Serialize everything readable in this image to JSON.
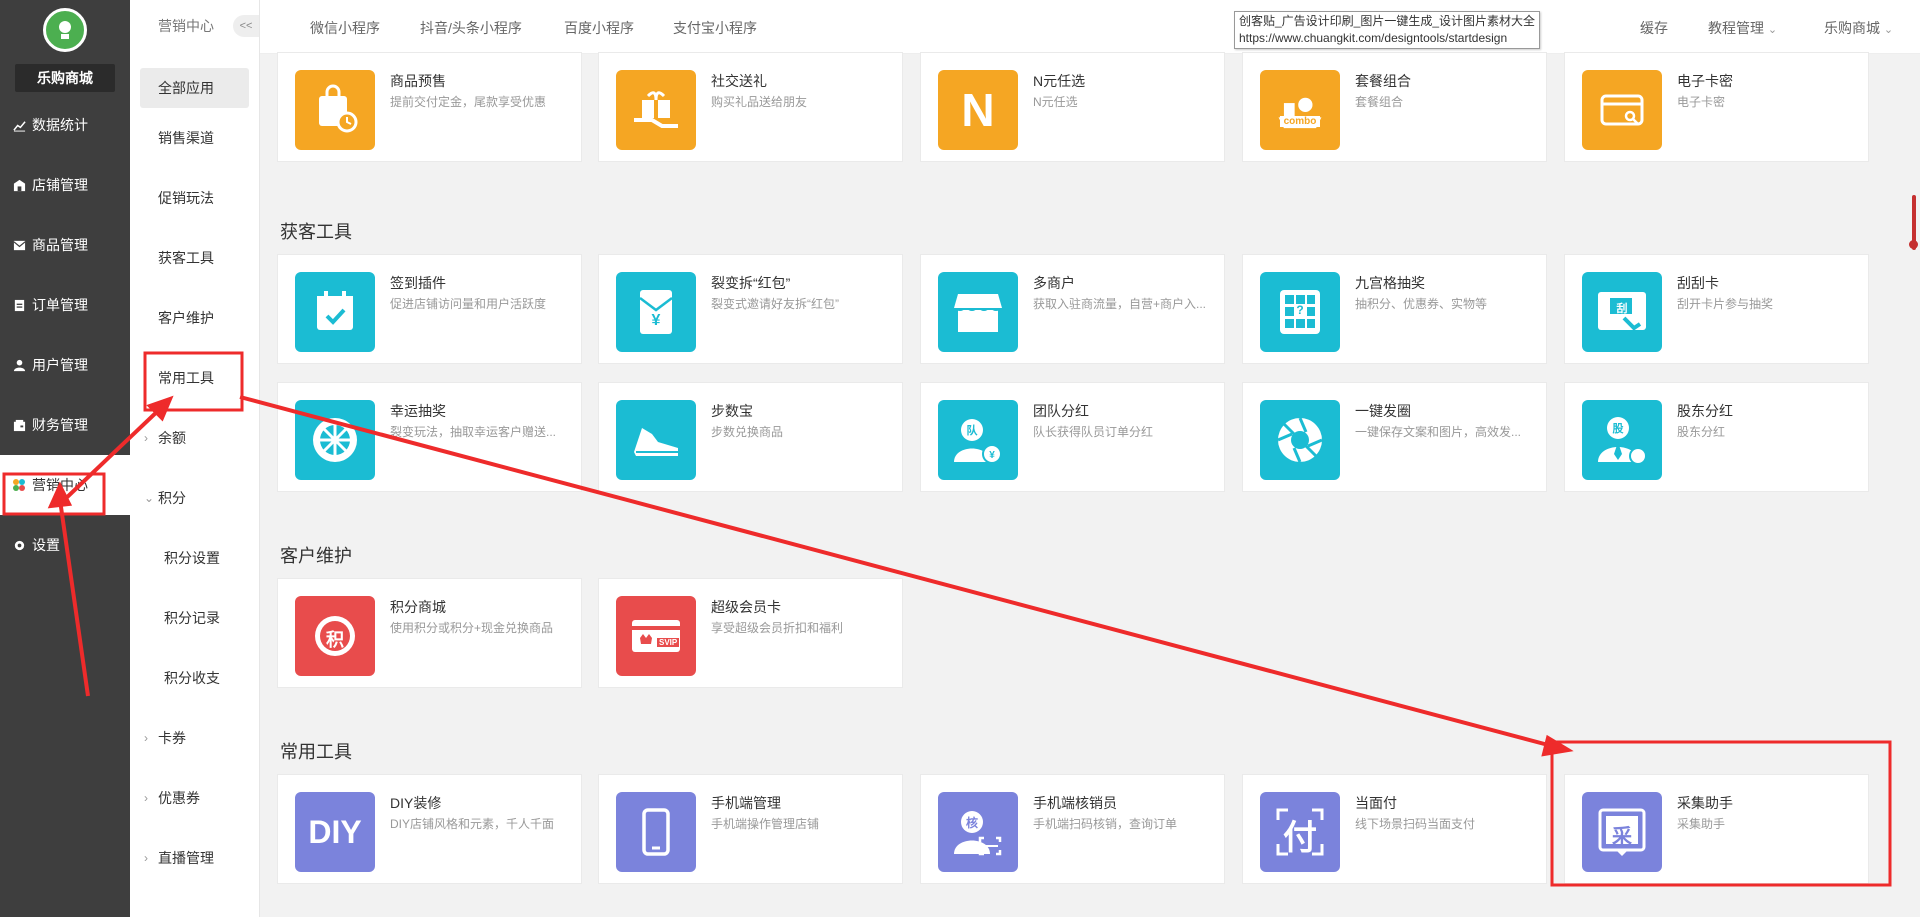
{
  "app": {
    "shop_name": "乐购商城"
  },
  "sidebar": {
    "items": [
      {
        "label": "数据统计",
        "icon": "chart-line-icon"
      },
      {
        "label": "店铺管理",
        "icon": "store-icon"
      },
      {
        "label": "商品管理",
        "icon": "mail-icon"
      },
      {
        "label": "订单管理",
        "icon": "clipboard-icon"
      },
      {
        "label": "用户管理",
        "icon": "user-icon"
      },
      {
        "label": "财务管理",
        "icon": "wallet-icon"
      },
      {
        "label": "营销中心",
        "icon": "colorful-dots-icon",
        "active": true
      },
      {
        "label": "设置",
        "icon": "gear-icon"
      }
    ]
  },
  "submenu": {
    "header": "营销中心",
    "collapse_label": "<<",
    "items": [
      {
        "label": "全部应用"
      },
      {
        "label": "销售渠道"
      },
      {
        "label": "促销玩法"
      },
      {
        "label": "获客工具"
      },
      {
        "label": "客户维护"
      },
      {
        "label": "常用工具"
      },
      {
        "label": "余额"
      },
      {
        "label": "积分"
      },
      {
        "label": "积分设置"
      },
      {
        "label": "积分记录"
      },
      {
        "label": "积分收支"
      },
      {
        "label": "卡券"
      },
      {
        "label": "优惠券"
      },
      {
        "label": "直播管理"
      }
    ]
  },
  "topbar": {
    "tabs": [
      "微信小程序",
      "抖音/头条小程序",
      "百度小程序",
      "支付宝小程序"
    ],
    "right": [
      "缓存",
      "教程管理",
      "乐购商城"
    ],
    "tooltip_line1": "创客贴_广告设计印刷_图片一键生成_设计图片素材大全",
    "tooltip_line2": "https://www.chuangkit.com/designtools/startdesign"
  },
  "sections": {
    "top_row": [
      {
        "title": "商品预售",
        "desc": "提前交付定金，尾款享受优惠",
        "color": "#f5a623",
        "icon": "shopping-bag-clock-icon"
      },
      {
        "title": "社交送礼",
        "desc": "购买礼品送给朋友",
        "color": "#f5a623",
        "icon": "gift-hand-icon"
      },
      {
        "title": "N元任选",
        "desc": "N元任选",
        "color": "#f5a623",
        "icon": "letter-n-icon",
        "icon_text": "N"
      },
      {
        "title": "套餐组合",
        "desc": "套餐组合",
        "color": "#f5a623",
        "icon": "combo-icon",
        "icon_text": "combo"
      },
      {
        "title": "电子卡密",
        "desc": "电子卡密",
        "color": "#f5a623",
        "icon": "card-key-icon"
      }
    ],
    "acquire": {
      "title": "获客工具",
      "cards": [
        {
          "title": "签到插件",
          "desc": "促进店铺访问量和用户活跃度",
          "color": "#1bbcd3",
          "icon": "calendar-check-icon"
        },
        {
          "title": "裂变拆“红包”",
          "desc": "裂变式邀请好友拆“红包”",
          "color": "#1bbcd3",
          "icon": "red-envelope-icon",
          "icon_text": "¥"
        },
        {
          "title": "多商户",
          "desc": "获取入驻商流量，自营+商户入...",
          "color": "#1bbcd3",
          "icon": "storefront-icon"
        },
        {
          "title": "九宫格抽奖",
          "desc": "抽积分、优惠券、实物等",
          "color": "#1bbcd3",
          "icon": "grid-lottery-icon",
          "icon_text": "?"
        },
        {
          "title": "刮刮卡",
          "desc": "刮开卡片参与抽奖",
          "color": "#1bbcd3",
          "icon": "scratch-card-icon",
          "icon_text": "刮"
        },
        {
          "title": "幸运抽奖",
          "desc": "裂变玩法，抽取幸运客户赠送...",
          "color": "#1bbcd3",
          "icon": "wheel-icon"
        },
        {
          "title": "步数宝",
          "desc": "步数兑换商品",
          "color": "#1bbcd3",
          "icon": "sneaker-icon"
        },
        {
          "title": "团队分红",
          "desc": "队长获得队员订单分红",
          "color": "#1bbcd3",
          "icon": "team-dividend-icon",
          "icon_text": "队"
        },
        {
          "title": "一键发圈",
          "desc": "一键保存文案和图片，高效发...",
          "color": "#1bbcd3",
          "icon": "aperture-icon"
        },
        {
          "title": "股东分红",
          "desc": "股东分红",
          "color": "#1bbcd3",
          "icon": "shareholder-icon",
          "icon_text": "股"
        }
      ]
    },
    "retention": {
      "title": "客户维护",
      "cards": [
        {
          "title": "积分商城",
          "desc": "使用积分或积分+现金兑换商品",
          "color": "#e84c4c",
          "icon": "points-mall-icon",
          "icon_text": "积"
        },
        {
          "title": "超级会员卡",
          "desc": "享受超级会员折扣和福利",
          "color": "#e84c4c",
          "icon": "svip-card-icon",
          "icon_text": "SVIP"
        }
      ]
    },
    "common": {
      "title": "常用工具",
      "cards": [
        {
          "title": "DIY装修",
          "desc": "DIY店铺风格和元素，千人千面",
          "color": "#7b83dc",
          "icon": "diy-icon",
          "icon_text": "DIY"
        },
        {
          "title": "手机端管理",
          "desc": "手机端操作管理店铺",
          "color": "#7b83dc",
          "icon": "mobile-phone-icon"
        },
        {
          "title": "手机端核销员",
          "desc": "手机端扫码核销，查询订单",
          "color": "#7b83dc",
          "icon": "verifier-icon",
          "icon_text": "核"
        },
        {
          "title": "当面付",
          "desc": "线下场景扫码当面支付",
          "color": "#7b83dc",
          "icon": "face-pay-icon",
          "icon_text": "付"
        },
        {
          "title": "采集助手",
          "desc": "采集助手",
          "color": "#7b83dc",
          "icon": "collect-icon",
          "icon_text": "采"
        }
      ]
    }
  },
  "annotation_color": "#ee2b2b"
}
